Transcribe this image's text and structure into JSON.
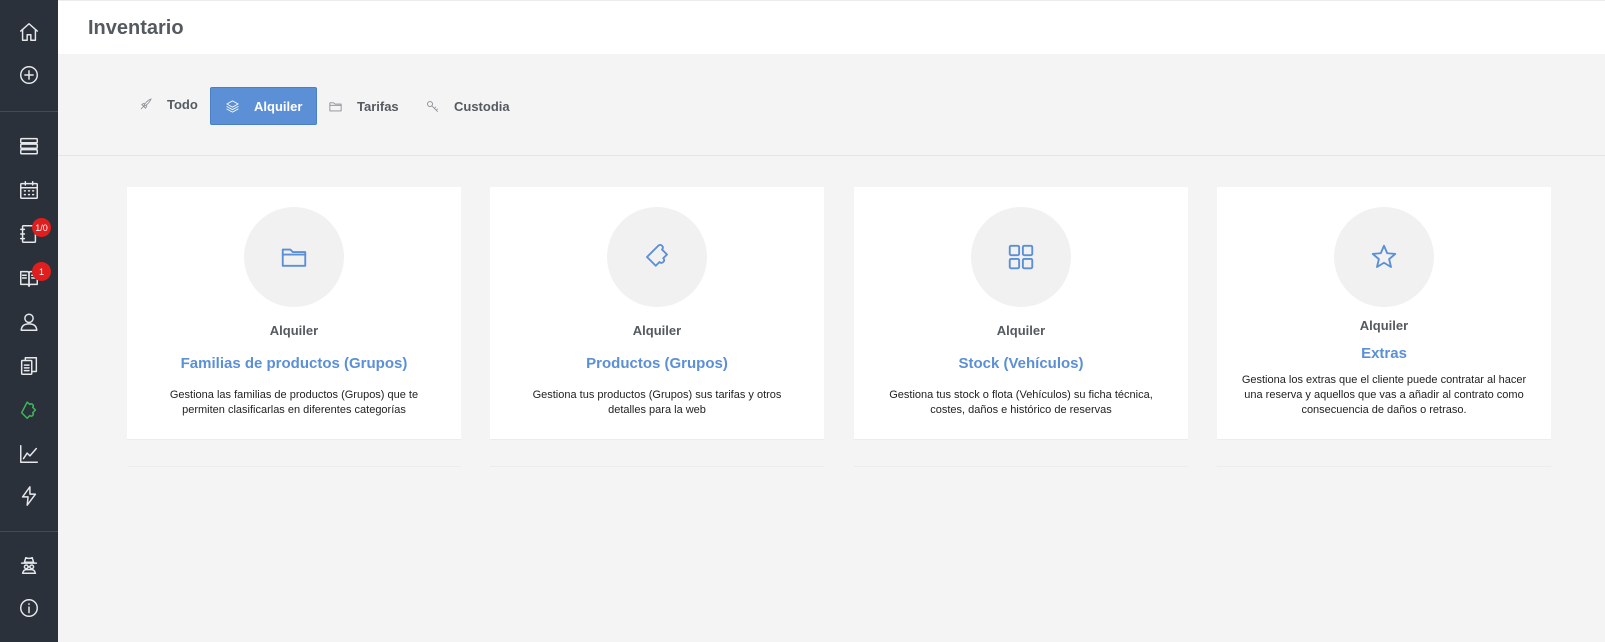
{
  "header": {
    "title": "Inventario"
  },
  "sidebar": {
    "items": [
      {
        "icon": "home-icon"
      },
      {
        "icon": "plus-circle-icon"
      },
      {
        "icon": "server-icon"
      },
      {
        "icon": "calendar-icon"
      },
      {
        "icon": "notebook-icon",
        "badge": "1/0"
      },
      {
        "icon": "book-icon",
        "badge": "1"
      },
      {
        "icon": "user-icon"
      },
      {
        "icon": "documents-icon"
      },
      {
        "icon": "puzzle-icon",
        "active": true
      },
      {
        "icon": "chart-icon"
      },
      {
        "icon": "bolt-icon"
      },
      {
        "icon": "spy-icon"
      },
      {
        "icon": "info-icon"
      }
    ]
  },
  "tabs": [
    {
      "label": "Todo",
      "icon": "rocket-icon"
    },
    {
      "label": "Alquiler",
      "icon": "layers-icon",
      "active": true
    },
    {
      "label": "Tarifas",
      "icon": "folder-icon"
    },
    {
      "label": "Custodia",
      "icon": "key-icon"
    }
  ],
  "cards": [
    {
      "icon": "folder-icon",
      "category": "Alquiler",
      "title": "Familias de productos (Grupos)",
      "description": "Gestiona las familias de productos (Grupos) que te permiten clasificarlas en diferentes categorías"
    },
    {
      "icon": "puzzle-icon",
      "category": "Alquiler",
      "title": "Productos (Grupos)",
      "description": "Gestiona tus productos (Grupos) sus tarifas y otros detalles para la web"
    },
    {
      "icon": "grid-icon",
      "category": "Alquiler",
      "title": "Stock (Vehículos)",
      "description": "Gestiona tus stock o flota (Vehículos) su ficha técnica, costes, daños e histórico de reservas"
    },
    {
      "icon": "star-icon",
      "category": "Alquiler",
      "title": "Extras",
      "description": "Gestiona los extras que el cliente puede contratar al hacer una reserva y aquellos que vas a añadir al contrato como consecuencia de daños o retraso."
    }
  ],
  "colors": {
    "sidebar": "#2b313a",
    "accent": "#5b8fd6",
    "active_icon": "#3fb75a",
    "badge": "#e01e1e"
  }
}
